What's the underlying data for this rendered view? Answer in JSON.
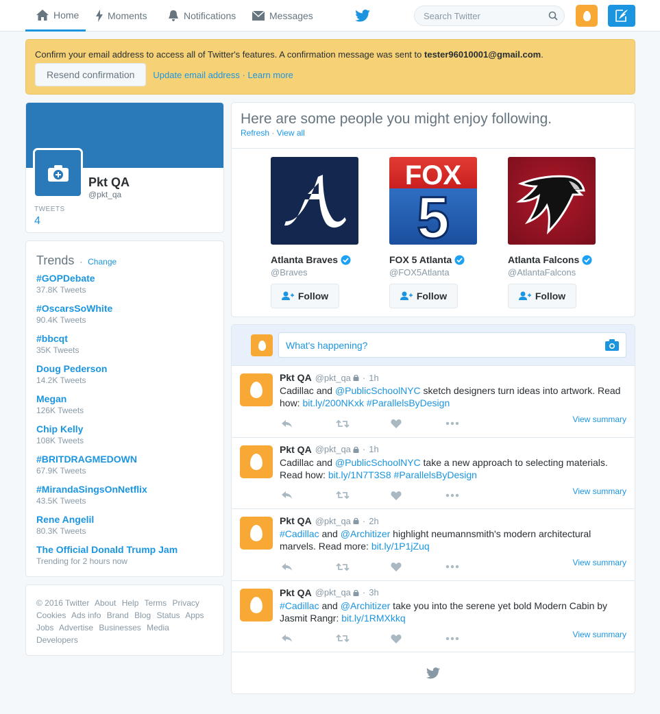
{
  "nav": {
    "home": "Home",
    "moments": "Moments",
    "notifications": "Notifications",
    "messages": "Messages",
    "search_placeholder": "Search Twitter"
  },
  "alert": {
    "message": "Confirm your email address to access all of Twitter's features. A confirmation message was sent to",
    "email": "tester96010001@gmail.com",
    "period": ".",
    "resend": "Resend confirmation",
    "update": "Update email address",
    "sep": " · ",
    "learn": "Learn more"
  },
  "profile": {
    "name": "Pkt QA",
    "handle": "@pkt_qa",
    "tweets_label": "TWEETS",
    "tweets_count": "4"
  },
  "trends": {
    "title": "Trends",
    "sep": "·",
    "change": "Change",
    "items": [
      {
        "name": "#GOPDebate",
        "count": "37.8K Tweets"
      },
      {
        "name": "#OscarsSoWhite",
        "count": "90.4K Tweets"
      },
      {
        "name": "#bbcqt",
        "count": "35K Tweets"
      },
      {
        "name": "Doug Pederson",
        "count": "14.2K Tweets"
      },
      {
        "name": "Megan",
        "count": "126K Tweets"
      },
      {
        "name": "Chip Kelly",
        "count": "108K Tweets"
      },
      {
        "name": "#BRITDRAGMEDOWN",
        "count": "67.9K Tweets"
      },
      {
        "name": "#MirandaSingsOnNetflix",
        "count": "43.5K Tweets"
      },
      {
        "name": "Rene Angelil",
        "count": "80.3K Tweets"
      },
      {
        "name": "The Official Donald Trump Jam",
        "count": "Trending for 2 hours now"
      }
    ]
  },
  "footer": {
    "links": [
      "© 2016 Twitter",
      "About",
      "Help",
      "Terms",
      "Privacy",
      "Cookies",
      "Ads info",
      "Brand",
      "Blog",
      "Status",
      "Apps",
      "Jobs",
      "Advertise",
      "Businesses",
      "Media",
      "Developers"
    ]
  },
  "wtf": {
    "title": "Here are some people you might enjoy following.",
    "refresh": "Refresh",
    "sep": " · ",
    "view_all": "View all",
    "follow_label": "Follow",
    "suggestions": [
      {
        "name": "Atlanta Braves",
        "handle": "@Braves"
      },
      {
        "name": "FOX 5 Atlanta",
        "handle": "@FOX5Atlanta"
      },
      {
        "name": "Atlanta Falcons",
        "handle": "@AtlantaFalcons"
      }
    ]
  },
  "composer": {
    "placeholder": "What's happening?"
  },
  "tweets": [
    {
      "name": "Pkt QA",
      "handle": "@pkt_qa",
      "time": "1h",
      "parts": [
        [
          "t",
          "Cadillac and "
        ],
        [
          "l",
          "@PublicSchoolNYC"
        ],
        [
          "t",
          " sketch designers turn ideas into artwork. Read how: "
        ],
        [
          "l",
          "bit.ly/200NKxk"
        ],
        [
          "t",
          " "
        ],
        [
          "l",
          "#ParallelsByDesign"
        ]
      ],
      "summary": "View summary"
    },
    {
      "name": "Pkt QA",
      "handle": "@pkt_qa",
      "time": "1h",
      "parts": [
        [
          "t",
          "Cadillac and "
        ],
        [
          "l",
          "@PublicSchoolNYC"
        ],
        [
          "t",
          " take a new approach to selecting materials. Read how: "
        ],
        [
          "l",
          "bit.ly/1N7T3S8"
        ],
        [
          "t",
          " "
        ],
        [
          "l",
          "#ParallelsByDesign"
        ]
      ],
      "summary": "View summary"
    },
    {
      "name": "Pkt QA",
      "handle": "@pkt_qa",
      "time": "2h",
      "parts": [
        [
          "l",
          "#Cadillac"
        ],
        [
          "t",
          " and "
        ],
        [
          "l",
          "@Architizer"
        ],
        [
          "t",
          " highlight neumannsmith's modern architectural marvels. Read more: "
        ],
        [
          "l",
          "bit.ly/1P1jZuq"
        ]
      ],
      "summary": "View summary"
    },
    {
      "name": "Pkt QA",
      "handle": "@pkt_qa",
      "time": "3h",
      "parts": [
        [
          "l",
          "#Cadillac"
        ],
        [
          "t",
          " and "
        ],
        [
          "l",
          "@Architizer"
        ],
        [
          "t",
          " take you into the serene yet bold Modern Cabin by Jasmit Rangr: "
        ],
        [
          "l",
          "bit.ly/1RMXkkq"
        ]
      ],
      "summary": "View summary"
    }
  ],
  "colors": {
    "brand": "#1b95e0",
    "alert_bg": "#f6d175",
    "egg": "#f8a935",
    "header_blue": "#2a7ab9"
  }
}
